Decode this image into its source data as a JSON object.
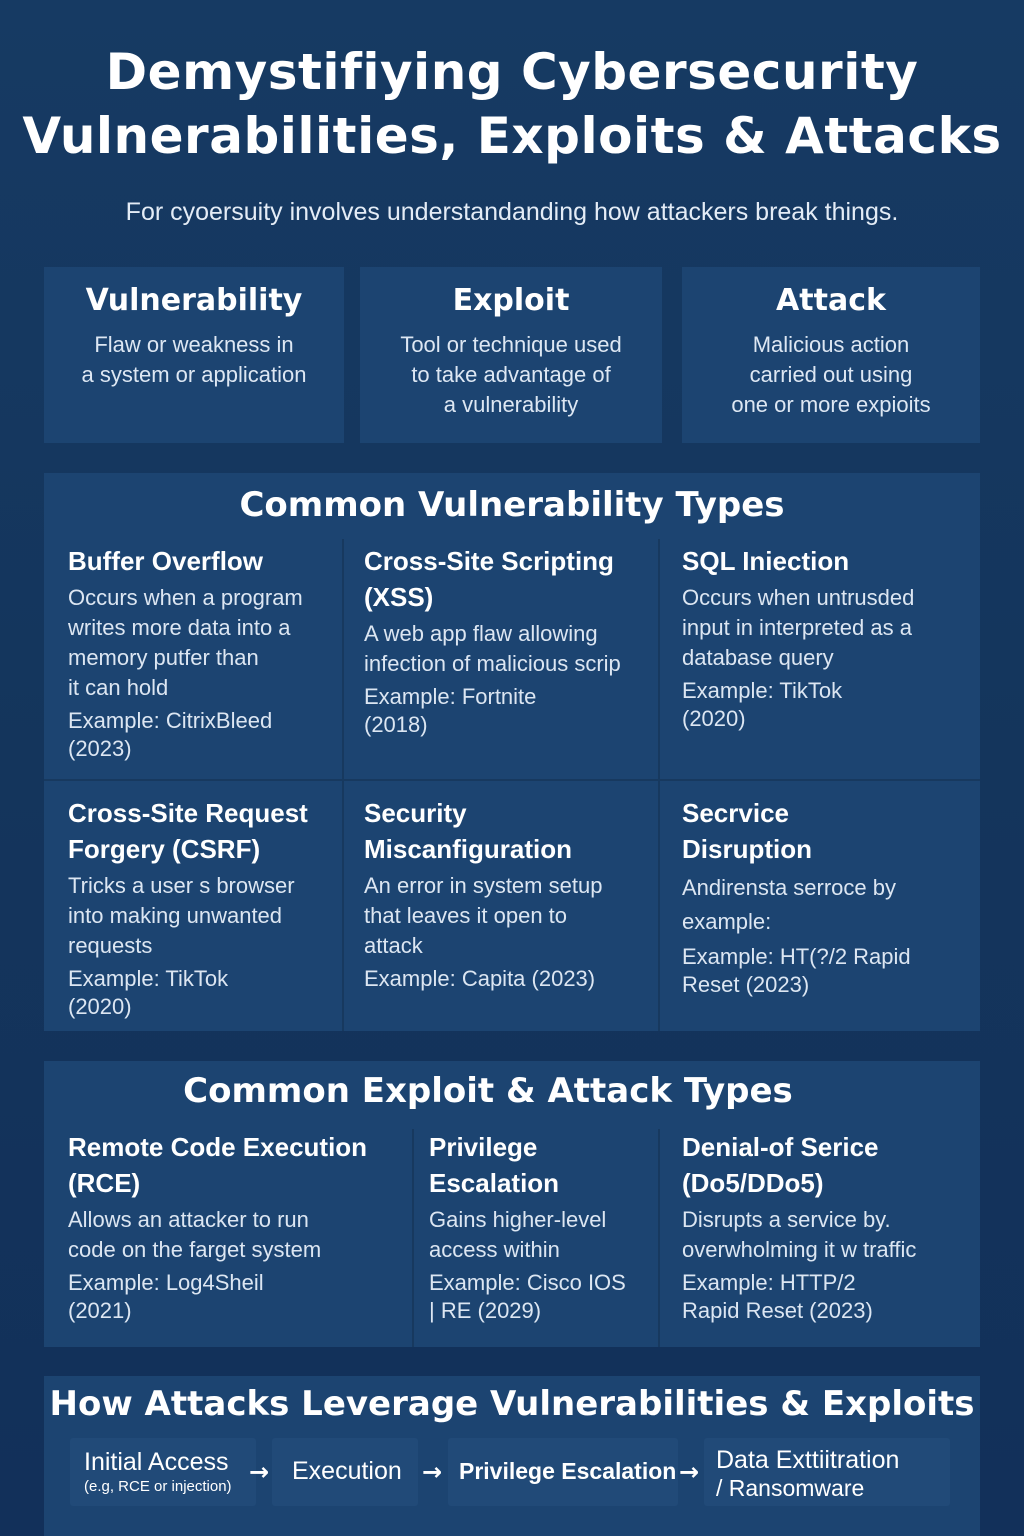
{
  "title_line1": "Demystifiying Cybersecurity",
  "title_line2": "Vulnerabilities, Exploits & Attacks",
  "subtitle": "For cyoersuity involves understandanding how attackers break things.",
  "definitions": [
    {
      "heading": "Vulnerability",
      "lines": [
        "Flaw or weakness in",
        "a system or application"
      ]
    },
    {
      "heading": "Exploit",
      "lines": [
        "Tool or technique used",
        "to take advantage of",
        "a vulnerability"
      ]
    },
    {
      "heading": "Attack",
      "lines": [
        "Malicious action",
        "carried out using",
        "one or more expioits"
      ]
    }
  ],
  "vuln_section": {
    "title": "Common Vulnerability Types",
    "items": [
      {
        "heading": [
          "Buffer Overflow"
        ],
        "desc": [
          "Occurs when a program",
          "writes more data into a",
          "memory putfer than",
          "it can hold"
        ],
        "example": [
          "Example: CitrixBleed",
          "(2023)"
        ]
      },
      {
        "heading": [
          "Cross-Site Scripting",
          "(XSS)"
        ],
        "desc": [
          "A web app flaw allowing",
          "infection of malicious scrip"
        ],
        "example": [
          "Example: Fortnite",
          "(2018)"
        ]
      },
      {
        "heading": [
          "SQL Iniection"
        ],
        "desc": [
          "Occurs when untrusded",
          "input in interpreted as a",
          "database query"
        ],
        "example": [
          "Example: TikTok",
          "(2020)"
        ]
      },
      {
        "heading": [
          "Cross-Site Request",
          "Forgery (CSRF)"
        ],
        "desc": [
          "Tricks a user s browser",
          "into making unwanted",
          "requests"
        ],
        "example": [
          "Example: TikTok",
          "(2020)"
        ]
      },
      {
        "heading": [
          "Security",
          "Miscanfiguration"
        ],
        "desc": [
          "An error in system setup",
          "that leaves it open to",
          "attack"
        ],
        "example": [
          "Example: Capita (2023)"
        ]
      },
      {
        "heading": [
          "Secrvice",
          "Disruption"
        ],
        "desc": [
          "Andirensta serroce by",
          "example:"
        ],
        "example": [
          "Example: HT(?/2 Rapid",
          "Reset (2023)"
        ]
      }
    ]
  },
  "exploit_section": {
    "title": "Common Exploit & Attack Types",
    "items": [
      {
        "heading": [
          "Remote Code Execution",
          "(RCE)"
        ],
        "desc": [
          "Allows an attacker to run",
          "code on the farget system"
        ],
        "example": [
          "Example: Log4Sheil",
          "(2021)"
        ]
      },
      {
        "heading": [
          "Privilege",
          "Escalation"
        ],
        "desc": [
          "Gains higher-level",
          "access within"
        ],
        "example": [
          "Example: Cisco IOS",
          "| RE (2029)"
        ]
      },
      {
        "heading": [
          "Denial-of Serice",
          "(Do5/DDo5)"
        ],
        "desc": [
          "Disrupts a service by.",
          "overwholming it w traffic"
        ],
        "example": [
          "Example: HTTP/2",
          "Rapid Reset (2023)"
        ]
      }
    ]
  },
  "flow_section": {
    "title": "How Attacks Leverage Vulnerabilities & Exploits",
    "steps": [
      {
        "label": "Initial Access",
        "sub": "(e.g, RCE or injection)"
      },
      {
        "label": "Execution",
        "sub": ""
      },
      {
        "label": "Privilege Escalation",
        "sub": ""
      },
      {
        "label": "Data Exttiitration",
        "sub": "/ Ransomware"
      }
    ],
    "arrow": "→"
  }
}
